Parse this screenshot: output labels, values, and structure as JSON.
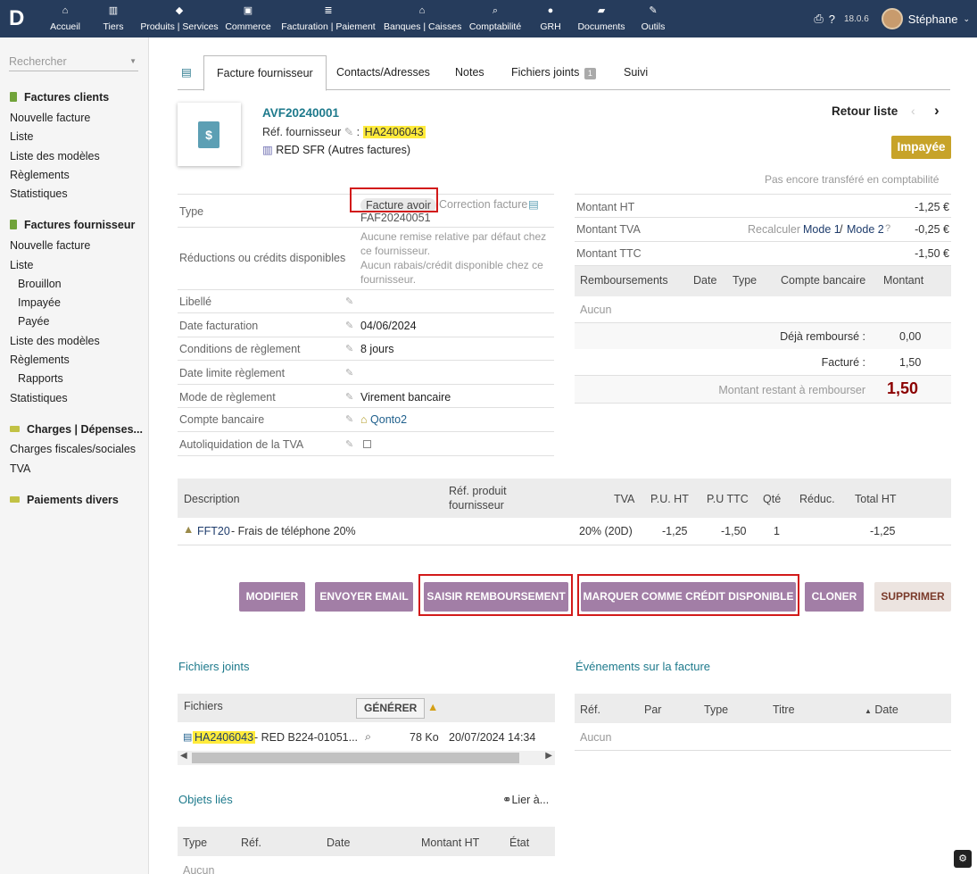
{
  "topbar": {
    "logo": "D",
    "menu": [
      {
        "label": "Accueil",
        "icon": "home-icon"
      },
      {
        "label": "Tiers",
        "icon": "building-icon"
      },
      {
        "label": "Produits | Services",
        "icon": "cube-icon"
      },
      {
        "label": "Commerce",
        "icon": "briefcase-icon"
      },
      {
        "label": "Facturation | Paiement",
        "icon": "invoice-icon"
      },
      {
        "label": "Banques | Caisses",
        "icon": "bank-icon"
      },
      {
        "label": "Comptabilité",
        "icon": "search-dollar-icon"
      },
      {
        "label": "GRH",
        "icon": "user-icon"
      },
      {
        "label": "Documents",
        "icon": "folder-icon"
      },
      {
        "label": "Outils",
        "icon": "wrench-icon"
      }
    ],
    "version": "18.0.6",
    "user": "Stéphane"
  },
  "sidebar": {
    "search_placeholder": "Rechercher",
    "items": [
      {
        "label": "Factures clients",
        "type": "head"
      },
      {
        "label": "Nouvelle facture"
      },
      {
        "label": "Liste"
      },
      {
        "label": "Liste des modèles"
      },
      {
        "label": "Règlements"
      },
      {
        "label": "Statistiques"
      },
      {
        "label": "Factures fournisseur",
        "type": "head"
      },
      {
        "label": "Nouvelle facture"
      },
      {
        "label": "Liste"
      },
      {
        "label": "Brouillon",
        "type": "sub"
      },
      {
        "label": "Impayée",
        "type": "sub"
      },
      {
        "label": "Payée",
        "type": "sub"
      },
      {
        "label": "Liste des modèles"
      },
      {
        "label": "Règlements"
      },
      {
        "label": "Rapports",
        "type": "sub"
      },
      {
        "label": "Statistiques"
      },
      {
        "label": "Charges | Dépenses...",
        "type": "head"
      },
      {
        "label": "Charges fiscales/sociales"
      },
      {
        "label": "TVA"
      },
      {
        "label": "Paiements divers",
        "type": "head"
      }
    ]
  },
  "tabs": [
    {
      "label": "Facture fournisseur"
    },
    {
      "label": "Contacts/Adresses"
    },
    {
      "label": "Notes"
    },
    {
      "label": "Fichiers joints",
      "badge": "1"
    },
    {
      "label": "Suivi"
    }
  ],
  "invoice": {
    "ref": "AVF20240001",
    "supplier_ref_label": "Réf. fournisseur",
    "supplier_ref": "HA2406043",
    "supplier": "RED SFR (Autres factures)",
    "back_list": "Retour liste",
    "status": "Impayée",
    "accounting_note": "Pas encore transféré en comptabilité"
  },
  "fields": {
    "type_label": "Type",
    "type_value": "Facture avoir",
    "correction_label": "Correction facture",
    "correction_ref": "FAF20240051",
    "reductions_label": "Réductions ou crédits disponibles",
    "reductions_line1": "Aucune remise relative par défaut chez",
    "reductions_line2": "ce fournisseur.",
    "reductions_line3": "Aucun rabais/crédit disponible chez ce",
    "reductions_line4": "fournisseur.",
    "libelle_label": "Libellé",
    "date_label": "Date facturation",
    "date_value": "04/06/2024",
    "conditions_label": "Conditions de règlement",
    "conditions_value": "8 jours",
    "limit_label": "Date limite règlement",
    "mode_label": "Mode de règlement",
    "mode_value": "Virement bancaire",
    "bank_label": "Compte bancaire",
    "bank_value": "Qonto2",
    "autoliq_label": "Autoliquidation de la TVA"
  },
  "amounts": {
    "ht_label": "Montant HT",
    "ht": "-1,25 €",
    "tva_label": "Montant TVA",
    "recalc": "Recalculer",
    "mode1": "Mode 1",
    "mode2": "Mode 2",
    "tva": "-0,25 €",
    "ttc_label": "Montant TTC",
    "ttc": "-1,50 €"
  },
  "refunds": {
    "headers": [
      "Remboursements",
      "Date",
      "Type",
      "Compte bancaire",
      "Montant"
    ],
    "empty": "Aucun",
    "already_label": "Déjà remboursé :",
    "already": "0,00",
    "invoiced_label": "Facturé :",
    "invoiced": "1,50",
    "remaining_label": "Montant restant à rembourser",
    "remaining": "1,50"
  },
  "lines": {
    "headers": [
      "Description",
      "Réf. produit",
      "fournisseur",
      "TVA",
      "P.U. HT",
      "P.U TTC",
      "Qté",
      "Réduc.",
      "Total HT"
    ],
    "rows": [
      {
        "code": "FFT20",
        "desc": " - Frais de téléphone 20%",
        "tva": "20% (20D)",
        "pu_ht": "-1,25",
        "pu_ttc": "-1,50",
        "qty": "1",
        "total": "-1,25"
      }
    ]
  },
  "actions": [
    "MODIFIER",
    "ENVOYER EMAIL",
    "SAISIR REMBOURSEMENT",
    "MARQUER COMME CRÉDIT DISPONIBLE",
    "CLONER",
    "SUPPRIMER"
  ],
  "files": {
    "title": "Fichiers joints",
    "header": "Fichiers",
    "generate": "GÉNÉRER",
    "file_ref": "HA2406043",
    "file_rest": " - RED B224-01051...",
    "size": "78 Ko",
    "date": "20/07/2024 14:34"
  },
  "events": {
    "title": "Événements sur la facture",
    "headers": [
      "Réf.",
      "Par",
      "Type",
      "Titre",
      "Date"
    ],
    "empty": "Aucun"
  },
  "linked": {
    "title": "Objets liés",
    "link": "Lier à...",
    "headers": [
      "Type",
      "Réf.",
      "Date",
      "Montant HT",
      "État"
    ],
    "empty": "Aucun"
  },
  "colors": {
    "topbar": "#263c5c",
    "accent": "#a27ea6",
    "status": "#c7a329",
    "link": "#1e7a8c"
  }
}
